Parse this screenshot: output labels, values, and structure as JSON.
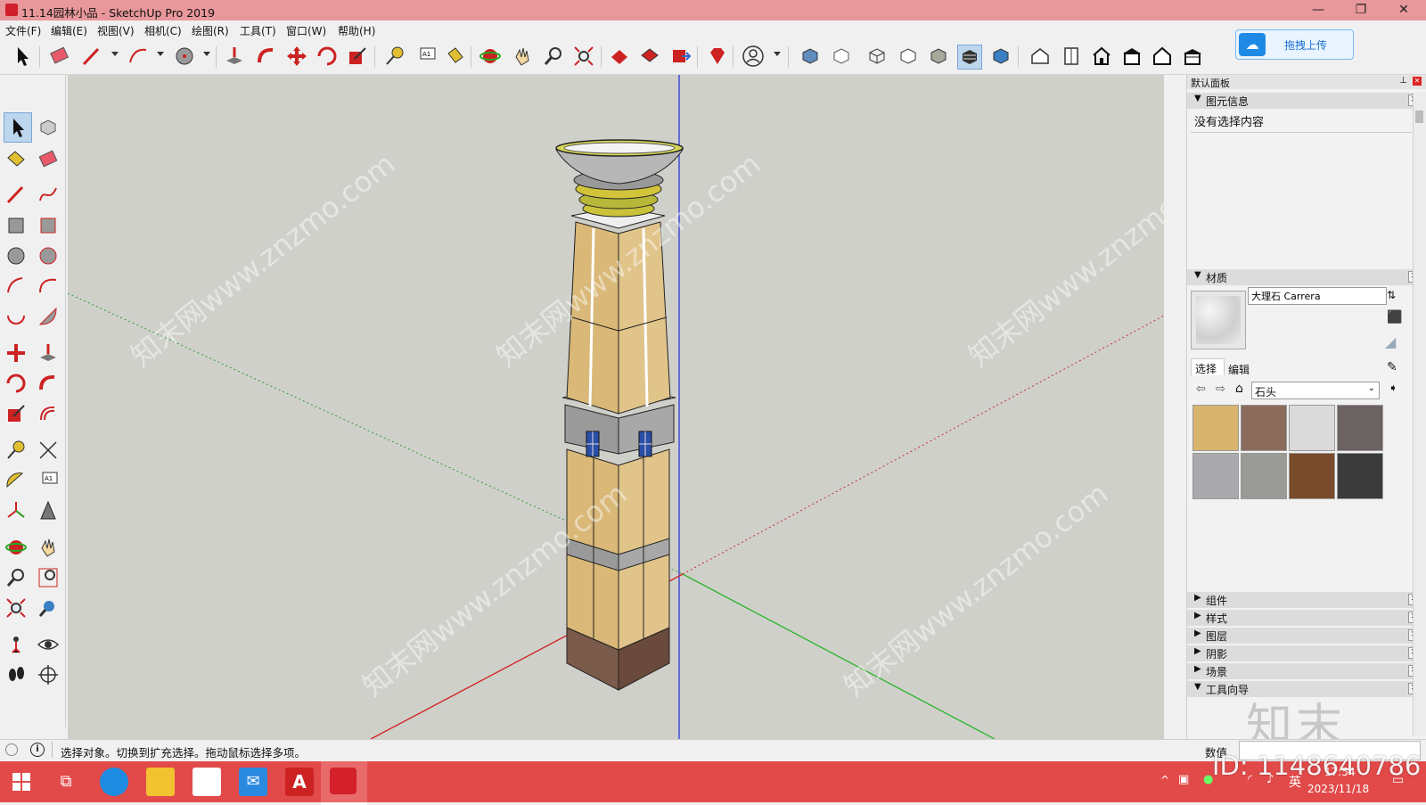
{
  "window": {
    "title": "11.14园林小品 - SketchUp Pro 2019",
    "buttons": {
      "minimize": "—",
      "restore": "❐",
      "close": "✕"
    }
  },
  "menu": [
    "文件(F)",
    "编辑(E)",
    "视图(V)",
    "相机(C)",
    "绘图(R)",
    "工具(T)",
    "窗口(W)",
    "帮助(H)"
  ],
  "upload_button": {
    "label": "拖拽上传"
  },
  "viewport": {
    "watermark": "知末网www.znzmo.com"
  },
  "right_panel": {
    "title": "默认面板",
    "entity_info": {
      "header": "图元信息",
      "status": "没有选择内容"
    },
    "materials": {
      "header": "材质",
      "material_name": "大理石 Carrera",
      "tabs": [
        "选择",
        "编辑"
      ],
      "library": "石头",
      "swatch_colors": [
        "#d7b36a",
        "#8a6a58",
        "#d9d9d9",
        "#6b6060",
        "#a9a9ad",
        "#9a9a95",
        "#7a4a2a",
        "#3a3a3a"
      ]
    },
    "collapsed_sections": [
      "组件",
      "样式",
      "图层",
      "阴影",
      "场景"
    ],
    "tool_guide": {
      "header": "工具向导"
    }
  },
  "status_bar": {
    "message": "选择对象。切换到扩充选择。拖动鼠标选择多项。",
    "measure_label": "数值"
  },
  "taskbar": {
    "ime": "英",
    "time": "17:54",
    "date": "2023/11/18",
    "overlay_text": "ID: 1148640786",
    "brand_watermark": "知末"
  }
}
